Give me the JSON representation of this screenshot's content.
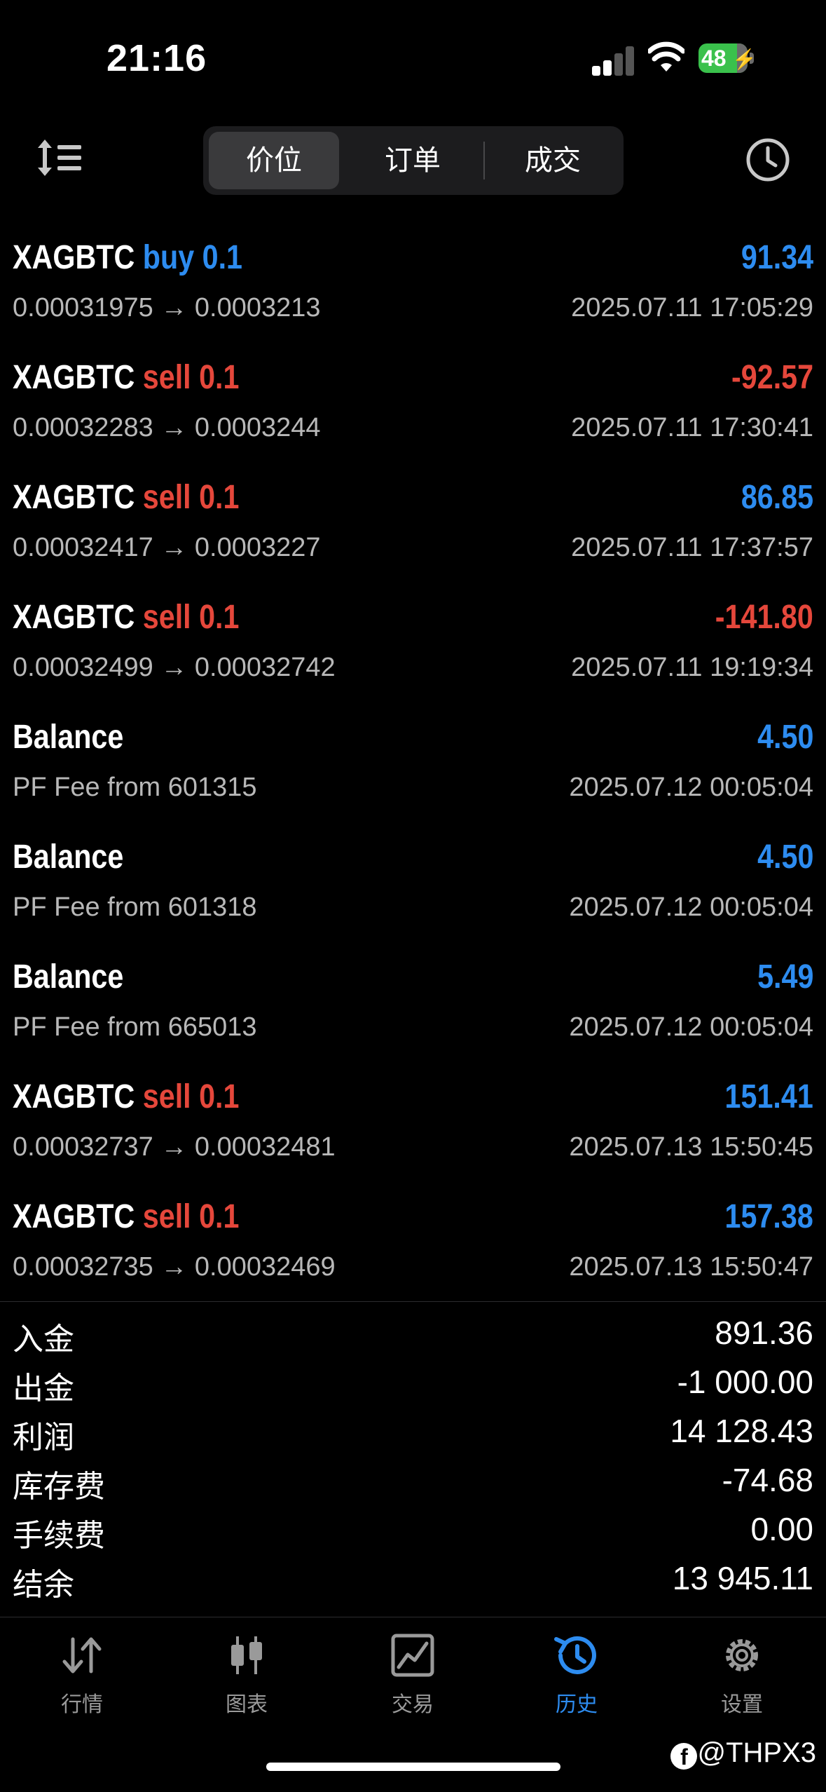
{
  "status_bar": {
    "time": "21:16",
    "battery": "48"
  },
  "segments": [
    {
      "label": "价位",
      "active": true
    },
    {
      "label": "订单",
      "active": false
    },
    {
      "label": "成交",
      "active": false
    }
  ],
  "deals": [
    {
      "symbol": "XAGBTC",
      "direction": "buy 0.1",
      "dir_type": "buy",
      "detail": "0.00031975 → 0.0003213",
      "profit": "91.34",
      "profit_sign": "pos",
      "date": "2025.07.11 17:05:29"
    },
    {
      "symbol": "XAGBTC",
      "direction": "sell 0.1",
      "dir_type": "sell",
      "detail": "0.00032283 → 0.0003244",
      "profit": "-92.57",
      "profit_sign": "neg",
      "date": "2025.07.11 17:30:41"
    },
    {
      "symbol": "XAGBTC",
      "direction": "sell 0.1",
      "dir_type": "sell",
      "detail": "0.00032417 → 0.0003227",
      "profit": "86.85",
      "profit_sign": "pos",
      "date": "2025.07.11 17:37:57"
    },
    {
      "symbol": "XAGBTC",
      "direction": "sell 0.1",
      "dir_type": "sell",
      "detail": "0.00032499 → 0.00032742",
      "profit": "-141.80",
      "profit_sign": "neg",
      "date": "2025.07.11 19:19:34"
    },
    {
      "symbol": "Balance",
      "direction": "",
      "dir_type": "",
      "detail": "PF Fee from 601315",
      "profit": "4.50",
      "profit_sign": "pos",
      "date": "2025.07.12 00:05:04"
    },
    {
      "symbol": "Balance",
      "direction": "",
      "dir_type": "",
      "detail": "PF Fee from 601318",
      "profit": "4.50",
      "profit_sign": "pos",
      "date": "2025.07.12 00:05:04"
    },
    {
      "symbol": "Balance",
      "direction": "",
      "dir_type": "",
      "detail": "PF Fee from 665013",
      "profit": "5.49",
      "profit_sign": "pos",
      "date": "2025.07.12 00:05:04"
    },
    {
      "symbol": "XAGBTC",
      "direction": "sell 0.1",
      "dir_type": "sell",
      "detail": "0.00032737 → 0.00032481",
      "profit": "151.41",
      "profit_sign": "pos",
      "date": "2025.07.13 15:50:45"
    },
    {
      "symbol": "XAGBTC",
      "direction": "sell 0.1",
      "dir_type": "sell",
      "detail": "0.00032735 → 0.00032469",
      "profit": "157.38",
      "profit_sign": "pos",
      "date": "2025.07.13 15:50:47"
    }
  ],
  "summary": [
    {
      "label": "入金",
      "value": "891.36"
    },
    {
      "label": "出金",
      "value": "-1 000.00"
    },
    {
      "label": "利润",
      "value": "14 128.43"
    },
    {
      "label": "库存费",
      "value": "-74.68"
    },
    {
      "label": "手续费",
      "value": "0.00"
    },
    {
      "label": "结余",
      "value": "13 945.11"
    }
  ],
  "tabs": [
    {
      "label": "行情",
      "icon": "quotes-arrows-icon",
      "active": false
    },
    {
      "label": "图表",
      "icon": "chart-candles-icon",
      "active": false
    },
    {
      "label": "交易",
      "icon": "trade-line-icon",
      "active": false
    },
    {
      "label": "历史",
      "icon": "history-clock-icon",
      "active": true
    },
    {
      "label": "设置",
      "icon": "gear-icon",
      "active": false
    }
  ],
  "watermark": "@THPX3",
  "colors": {
    "positive": "#2d8cf0",
    "negative": "#e5473b",
    "muted": "#b8b8b8",
    "tab_inactive": "#9a9a9a"
  }
}
